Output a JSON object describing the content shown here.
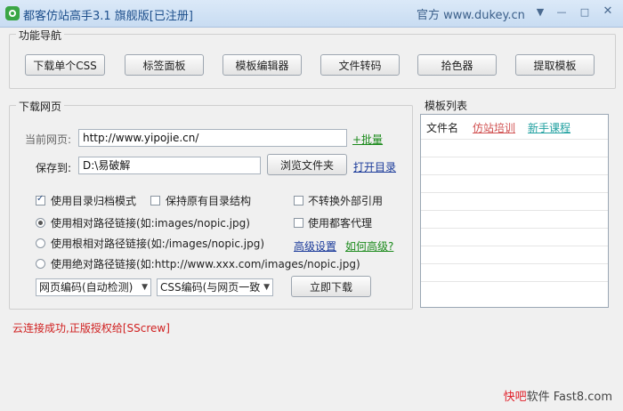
{
  "window": {
    "title": "都客仿站高手3.1 旗舰版[已注册]",
    "site": "官方 www.dukey.cn"
  },
  "nav": {
    "legend": "功能导航",
    "buttons": [
      "下载单个CSS",
      "标签面板",
      "模板编辑器",
      "文件转码",
      "拾色器",
      "提取模板"
    ]
  },
  "download": {
    "legend": "下载网页",
    "current_label": "当前网页:",
    "url_value": "http://www.yipojie.cn/",
    "batch_link": "+批量",
    "save_label": "保存到:",
    "save_value": "D:\\易破解",
    "browse_button": "浏览文件夹",
    "open_dir_link": "打开目录",
    "options": {
      "archive_mode": "使用目录归档模式",
      "keep_structure": "保持原有目录结构",
      "no_convert": "不转换外部引用",
      "use_proxy": "使用都客代理",
      "relative": "使用相对路径链接(如:images/nopic.jpg)",
      "root_relative": "使用根相对路径链接(如:/images/nopic.jpg)",
      "absolute": "使用绝对路径链接(如:http://www.xxx.com/images/nopic.jpg)"
    },
    "advanced_link": "高级设置",
    "how_advanced_link": "如何高级?",
    "page_encoding": "网页编码(自动检测)",
    "css_encoding": "CSS编码(与网页一致",
    "download_now": "立即下载"
  },
  "templates": {
    "legend": "模板列表",
    "header_file": "文件名",
    "tag_imitate": "仿站培训",
    "tag_novice": "新手课程"
  },
  "status": "云连接成功,正版授权给[SScrew]",
  "watermark": {
    "prefix": "快吧",
    "suffix": "软件 Fast8.com"
  }
}
